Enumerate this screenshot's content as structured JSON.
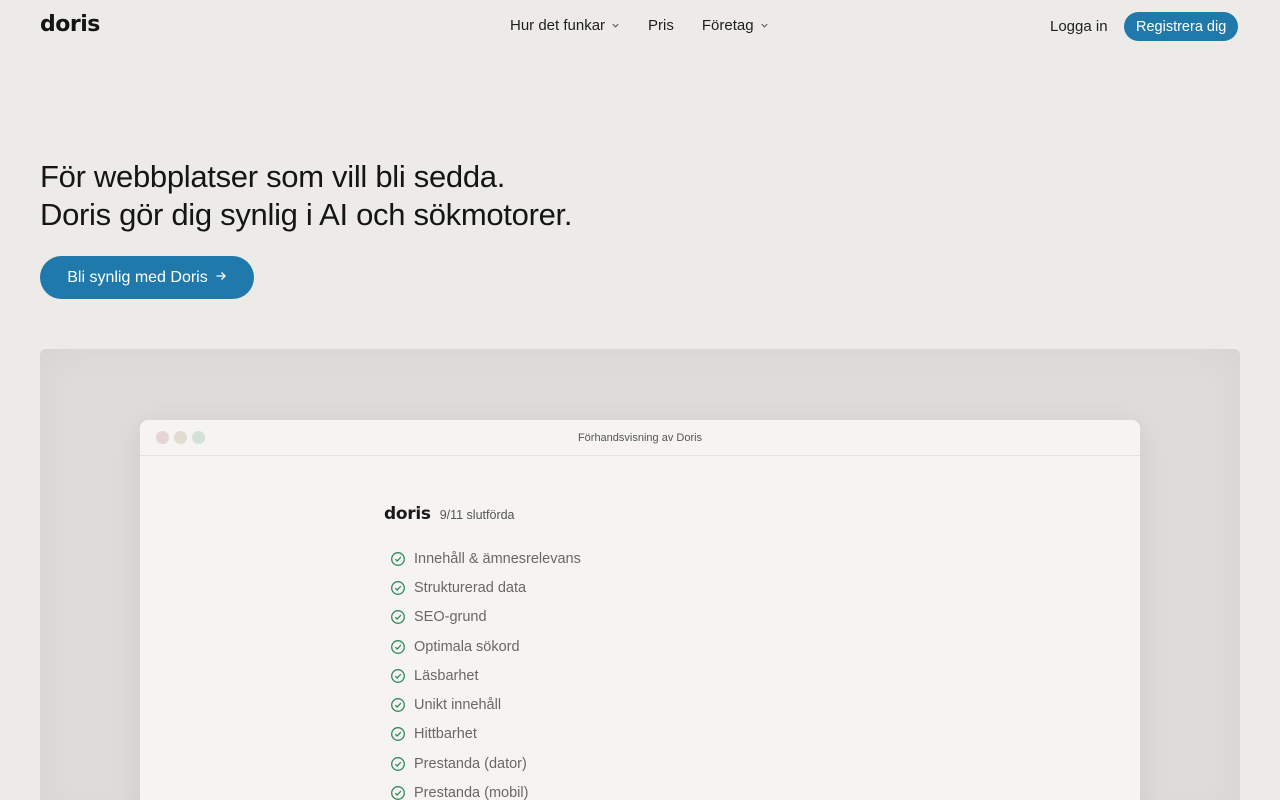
{
  "nav": {
    "logo": "doris",
    "links": [
      {
        "label": "Hur det funkar",
        "has_dropdown": true
      },
      {
        "label": "Pris",
        "has_dropdown": false
      },
      {
        "label": "Företag",
        "has_dropdown": true
      }
    ],
    "login": "Logga in",
    "signup": "Registrera dig"
  },
  "hero": {
    "line1": "För webbplatser som vill bli sedda.",
    "line2": "Doris gör dig synlig i AI och sökmotorer.",
    "cta": "Bli synlig med Doris",
    "cta_icon": "arrow-right-icon"
  },
  "preview": {
    "window_title": "Förhandsvisning av Doris",
    "logo": "doris",
    "progress": "9/11 slutförda",
    "items": [
      "Innehåll & ämnesrelevans",
      "Strukturerad data",
      "SEO-grund",
      "Optimala sökord",
      "Läsbarhet",
      "Unikt innehåll",
      "Hittbarhet",
      "Prestanda (dator)",
      "Prestanda (mobil)"
    ]
  },
  "colors": {
    "accent": "#1f79ab",
    "check": "#2f8a5a",
    "background": "#ecebe8"
  }
}
